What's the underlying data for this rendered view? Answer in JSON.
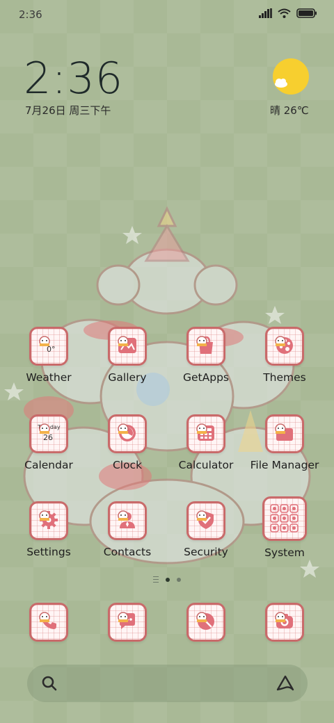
{
  "status_bar": {
    "time": "2:36",
    "icons": [
      "signal-icon",
      "wifi-icon",
      "battery-icon"
    ]
  },
  "clock_widget": {
    "time": "2:36",
    "date": "7月26日 周三下午"
  },
  "weather_widget": {
    "icon": "sun-cloud-icon",
    "text": "晴 26℃"
  },
  "apps": [
    {
      "label": "Weather",
      "icon": "weather-icon",
      "tile_text": "0°"
    },
    {
      "label": "Gallery",
      "icon": "gallery-icon"
    },
    {
      "label": "GetApps",
      "icon": "shopping-bag-icon"
    },
    {
      "label": "Themes",
      "icon": "palette-icon"
    },
    {
      "label": "Calendar",
      "icon": "calendar-icon",
      "tile_text": "Tuesday",
      "tile_num": "26"
    },
    {
      "label": "Clock",
      "icon": "clock-icon"
    },
    {
      "label": "Calculator",
      "icon": "calculator-icon"
    },
    {
      "label": "File Manager",
      "icon": "folder-icon"
    },
    {
      "label": "Settings",
      "icon": "gear-icon"
    },
    {
      "label": "Contacts",
      "icon": "contact-icon"
    },
    {
      "label": "Security",
      "icon": "shield-icon"
    },
    {
      "label": "System",
      "icon": "folder-grid-icon"
    }
  ],
  "dock": [
    {
      "icon": "phone-icon"
    },
    {
      "icon": "message-icon"
    },
    {
      "icon": "browser-icon"
    },
    {
      "icon": "camera-icon"
    }
  ],
  "page_indicator": {
    "pages": 2,
    "current": 1
  },
  "search_bar": {
    "left_icon": "search-icon",
    "right_icon": "assistant-icon"
  },
  "colors": {
    "wallpaper": "#a9b996",
    "tile_border": "#c96a6a",
    "tile_fill": "#fff5f5",
    "glyph": "#e0707a"
  }
}
